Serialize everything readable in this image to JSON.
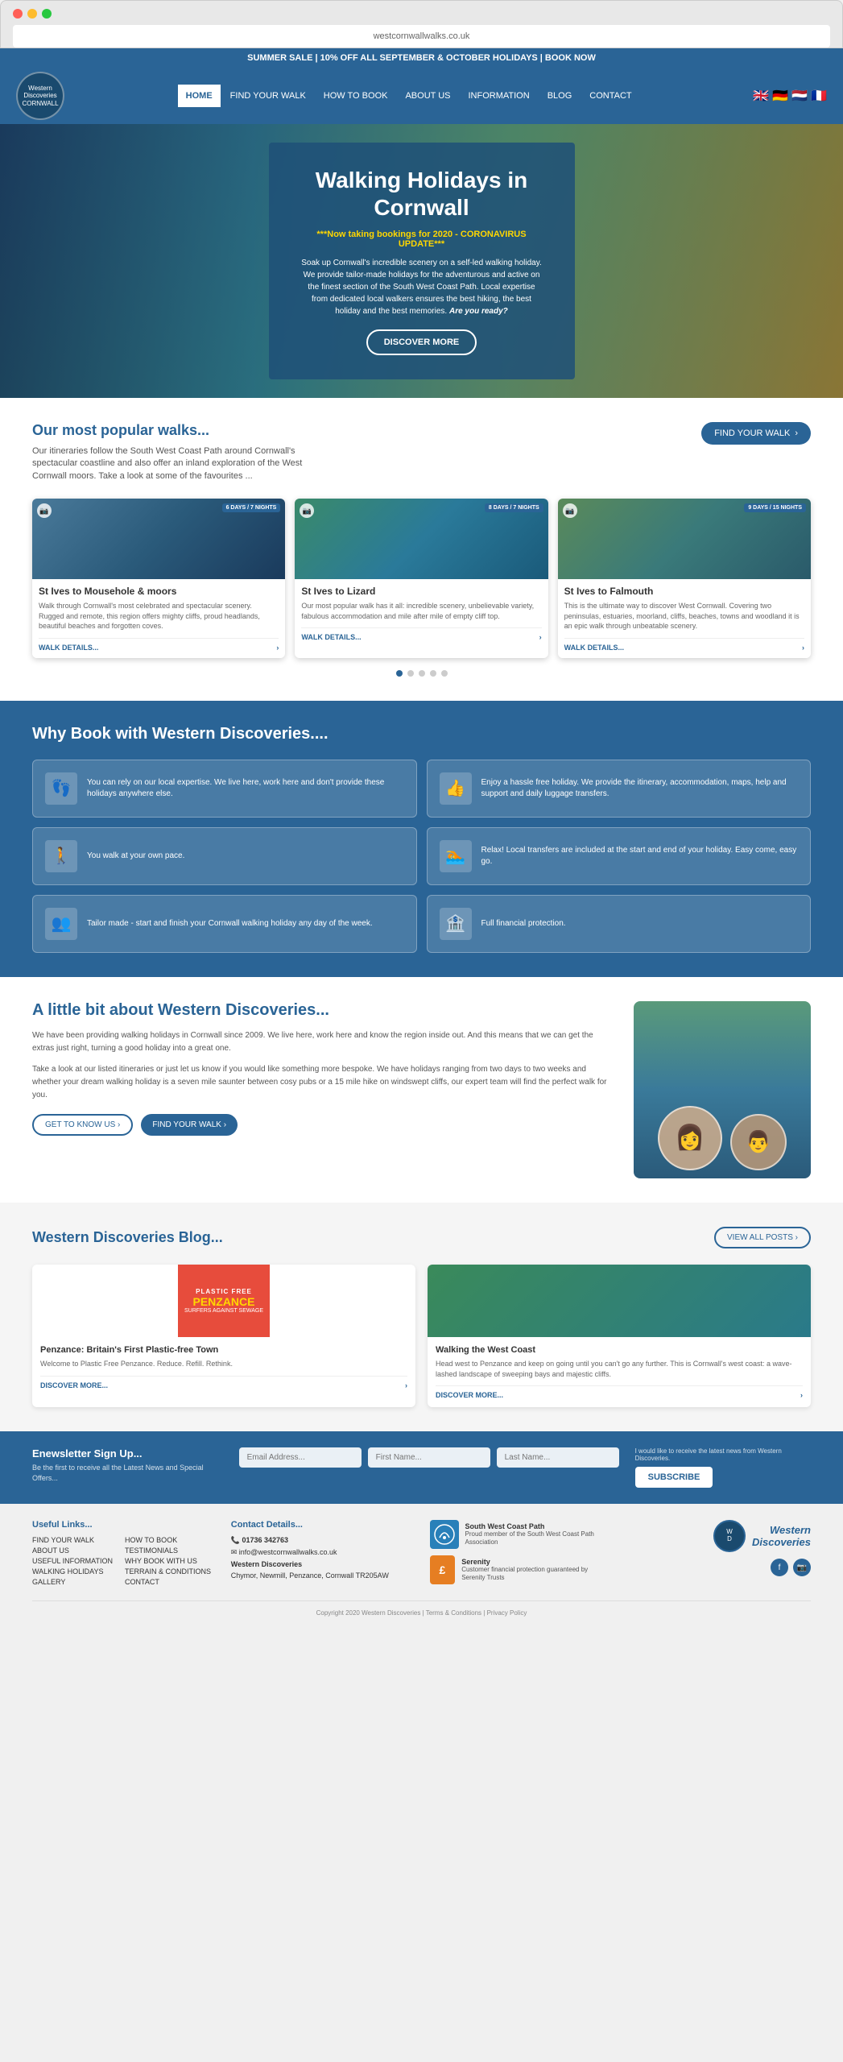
{
  "browser": {
    "url": "westcornwallwalks.co.uk"
  },
  "topBanner": {
    "text": "SUMMER SALE | 10% OFF ALL SEPTEMBER & OCTOBER HOLIDAYS | BOOK NOW"
  },
  "nav": {
    "logo": {
      "line1": "Western",
      "line2": "Discoveries",
      "line3": "CORNWALL"
    },
    "links": [
      {
        "label": "HOME",
        "active": true
      },
      {
        "label": "FIND YOUR WALK",
        "active": false
      },
      {
        "label": "HOW TO BOOK",
        "active": false
      },
      {
        "label": "ABOUT US",
        "active": false
      },
      {
        "label": "INFORMATION",
        "active": false
      },
      {
        "label": "BLOG",
        "active": false
      },
      {
        "label": "CONTACT",
        "active": false
      }
    ]
  },
  "hero": {
    "title": "Walking Holidays in Cornwall",
    "subtitle": "***Now taking bookings for 2020 - CORONAVIRUS UPDATE***",
    "text": "Soak up Cornwall's incredible scenery on a self-led walking holiday. We provide tailor-made holidays for the adventurous and active on the finest section of the South West Coast Path. Local expertise from dedicated local walkers ensures the best hiking, the best holiday and the best memories.",
    "text_bold": "Are you ready?",
    "button": "DISCOVER MORE"
  },
  "popularWalks": {
    "title": "Our most popular walks...",
    "desc": "Our itineraries follow the South West Coast Path around Cornwall's spectacular coastline and also offer an inland exploration of the West Cornwall moors. Take a look at some of the favourites ...",
    "findWalkButton": "FIND YOUR WALK",
    "cards": [
      {
        "title": "St Ives to Mousehole & moors",
        "badge": "6 DAYS / 7 NIGHTS",
        "desc": "Walk through Cornwall's most celebrated and spectacular scenery. Rugged and remote, this region offers mighty cliffs, proud headlands, beautiful beaches and forgotten coves.",
        "link": "WALK DETAILS...",
        "imgClass": "card-img-st-ives"
      },
      {
        "title": "St Ives to Lizard",
        "badge": "8 DAYS / 7 NIGHTS",
        "desc": "Our most popular walk has it all: incredible scenery, unbelievable variety, fabulous accommodation and mile after mile of empty cliff top.",
        "link": "WALK DETAILS...",
        "imgClass": "card-img-lizard"
      },
      {
        "title": "St Ives to Falmouth",
        "badge": "9 DAYS / 15 NIGHTS",
        "desc": "This is the ultimate way to discover West Cornwall. Covering two peninsulas, estuaries, moorland, cliffs, beaches, towns and woodland it is an epic walk through unbeatable scenery.",
        "link": "WALK DETAILS...",
        "imgClass": "card-img-falmouth"
      }
    ]
  },
  "whyBook": {
    "title": "Why Book with Western Discoveries....",
    "reasons": [
      {
        "icon": "👣",
        "text": "You can rely on our local expertise. We live here, work here and don't provide these holidays anywhere else."
      },
      {
        "icon": "👍",
        "text": "Enjoy a hassle free holiday. We provide the itinerary, accommodation, maps, help and support and daily luggage transfers."
      },
      {
        "icon": "🚶",
        "text": "You walk at your own pace."
      },
      {
        "icon": "🏊",
        "text": "Relax! Local transfers are included at the start and end of your holiday. Easy come, easy go."
      },
      {
        "icon": "👥",
        "text": "Tailor made - start and finish your Cornwall walking holiday any day of the week."
      },
      {
        "icon": "🏦",
        "text": "Full financial protection."
      }
    ]
  },
  "about": {
    "title": "A little bit about Western Discoveries...",
    "para1": "We have been providing walking holidays in Cornwall since 2009. We live here, work here and know the region inside out. And this means that we can get the extras just right, turning a good holiday into a great one.",
    "para2": "Take a look at our listed itineraries or just let us know if you would like something more bespoke. We have holidays ranging from two days to two weeks and whether your dream walking holiday is a seven mile saunter between cosy pubs or a 15 mile hike on windswept cliffs, our expert team will find the perfect walk for you.",
    "btn1": "GET TO KNOW US ›",
    "btn2": "FIND YOUR WALK ›"
  },
  "blog": {
    "title": "Western Discoveries Blog...",
    "viewAllButton": "VIEW ALL POSTS ›",
    "posts": [
      {
        "title": "Penzance: Britain's First Plastic-free Town",
        "text": "Welcome to Plastic Free Penzance. Reduce. Refill. Rethink.",
        "link": "DISCOVER MORE...",
        "type": "penzance"
      },
      {
        "title": "Walking the West Coast",
        "text": "Head west to Penzance and keep on going until you can't go any further. This is Cornwall's west coast: a wave-lashed landscape of sweeping bays and majestic cliffs.",
        "link": "DISCOVER MORE...",
        "type": "coast"
      }
    ]
  },
  "newsletter": {
    "title": "Enewsletter Sign Up...",
    "subtitle": "Be the first to receive all the Latest News and Special Offers...",
    "emailPlaceholder": "Email Address...",
    "firstNamePlaceholder": "First Name...",
    "lastNamePlaceholder": "Last Name...",
    "checkboxText": "I would like to receive the latest news from Western Discoveries.",
    "button": "SUBSCRIBE"
  },
  "footer": {
    "usefulLinks": {
      "title": "Useful Links...",
      "col1": [
        "FIND YOUR WALK",
        "ABOUT US",
        "USEFUL INFORMATION",
        "WALKING HOLIDAYS",
        "GALLERY"
      ],
      "col2": [
        "HOW TO BOOK",
        "TESTIMONIALS",
        "WHY BOOK WITH US",
        "TERRAIN & CONDITIONS",
        "CONTACT"
      ]
    },
    "contact": {
      "title": "Contact Details...",
      "phone": "01736 342763",
      "email": "info@westcornwallwalks.co.uk",
      "company": "Western Discoveries",
      "address": "Chymor, Newmill, Penzance, Cornwall TR205AW"
    },
    "badges": [
      {
        "name": "South West Coast Path",
        "text": "Proud member of the South West Coast Path Association"
      },
      {
        "name": "Serenity",
        "text": "Customer financial protection guaranteed by Serenity Trusts"
      }
    ],
    "logo": {
      "name": "Western Discoveries",
      "tagline": ""
    },
    "copyright": "Copyright 2020 Western Discoveries | Terms & Conditions | Privacy Policy"
  }
}
